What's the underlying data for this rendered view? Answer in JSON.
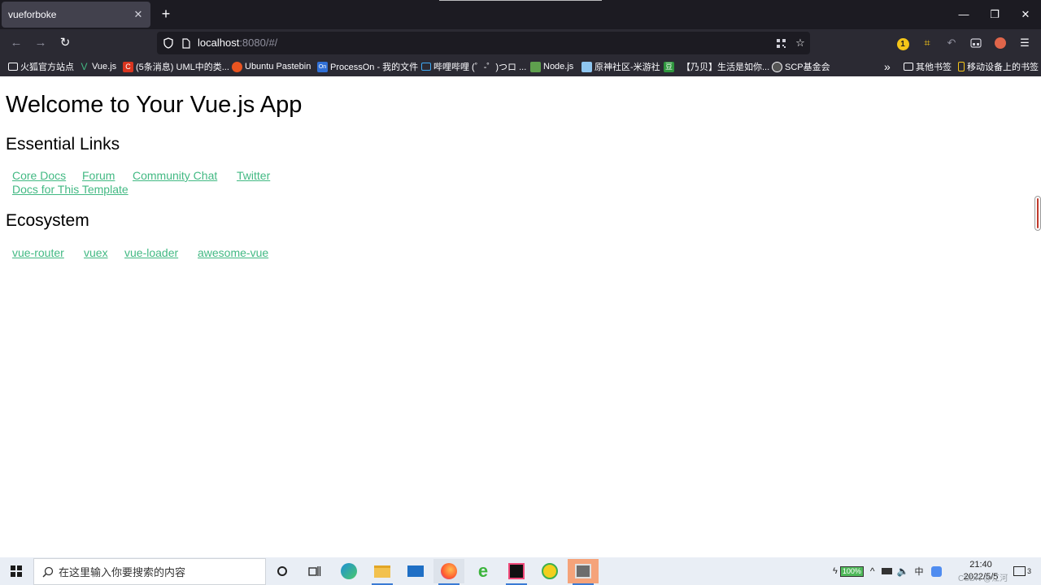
{
  "browser": {
    "tab_title": "vueforboke",
    "tab_close": "✕",
    "new_tab": "+",
    "window_controls": {
      "minimize": "—",
      "restore": "❐",
      "close": "✕"
    },
    "nav": {
      "back": "←",
      "forward": "→",
      "reload": "↻"
    },
    "url_host": "localhost",
    "url_rest": ":8080/#/",
    "bookmarks": [
      {
        "label": "火狐官方站点",
        "icon": "folder-icon"
      },
      {
        "label": "Vue.js",
        "icon": "vue-icon"
      },
      {
        "label": "(5条消息) UML中的类...",
        "icon": "csdn-icon"
      },
      {
        "label": "Ubuntu Pastebin",
        "icon": "ubuntu-icon"
      },
      {
        "label": "ProcessOn - 我的文件",
        "icon": "processon-icon"
      },
      {
        "label": "哔哩哔哩 (゜-゜)つロ ...",
        "icon": "bilibili-icon"
      },
      {
        "label": "Node.js",
        "icon": "nodejs-icon"
      },
      {
        "label": "原神社区-米游社",
        "icon": "miyoushe-icon"
      },
      {
        "label": "",
        "icon": "douban-icon"
      },
      {
        "label": "【乃贝】生活是如你...",
        "icon": "blank-icon"
      },
      {
        "label": "SCP基金会",
        "icon": "scp-icon"
      }
    ],
    "bookmarks_overflow": "»",
    "other_bookmarks": "其他书签",
    "mobile_bookmarks": "移动设备上的书签"
  },
  "page": {
    "title": "Welcome to Your Vue.js App",
    "essential_heading": "Essential Links",
    "essential_links": [
      "Core Docs",
      "Forum",
      "Community Chat",
      "Twitter",
      "Docs for This Template"
    ],
    "ecosystem_heading": "Ecosystem",
    "ecosystem_links": [
      "vue-router",
      "vuex",
      "vue-loader",
      "awesome-vue"
    ]
  },
  "taskbar": {
    "search_placeholder": "在这里输入你要搜索的内容",
    "battery": "100%",
    "ime": "中",
    "time": "21:40",
    "date": "2022/5/5",
    "watermark": "CSDN @江河",
    "notification_count": "3"
  },
  "colors": {
    "link": "#42b983",
    "chrome_dark": "#1c1b22",
    "chrome": "#2b2a33",
    "taskbar": "#e9eef5"
  }
}
